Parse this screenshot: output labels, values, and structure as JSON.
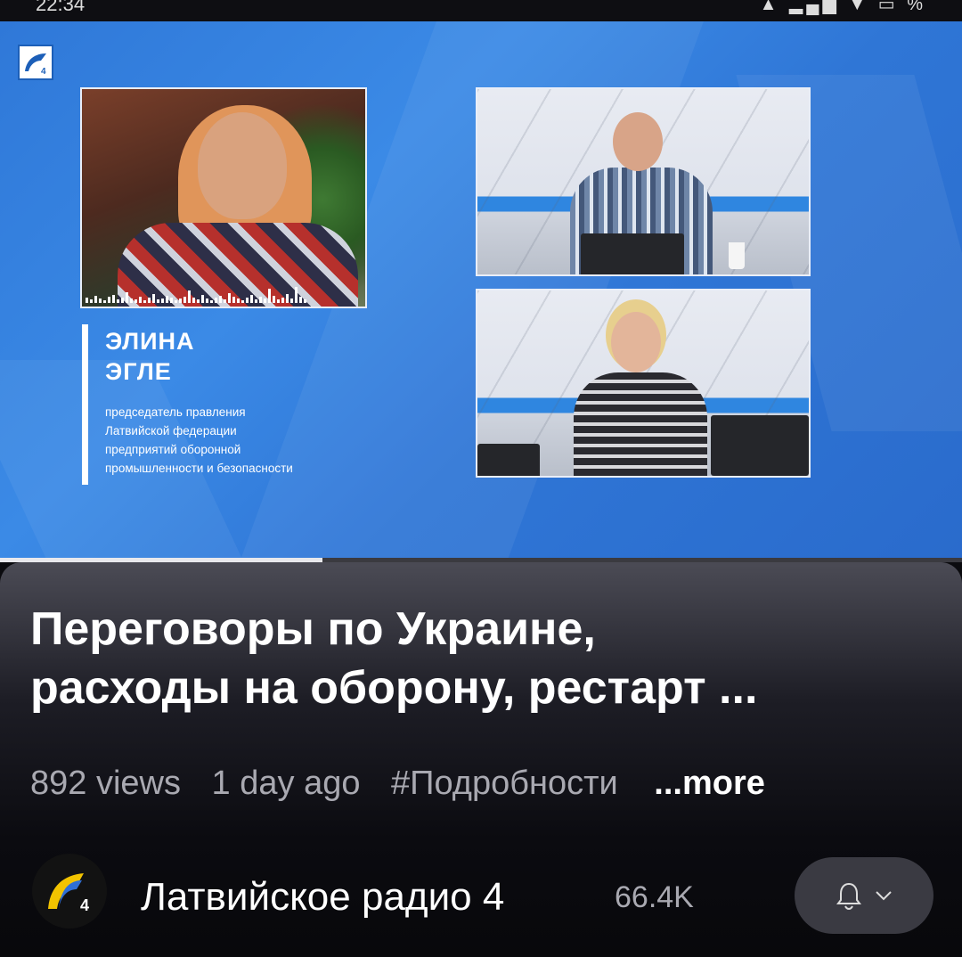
{
  "status_bar": {
    "time": "22:34",
    "icons_text": "▲ ▂▄▆ ▼ ▭ %"
  },
  "video": {
    "guest_name_line1": "ЭЛИНА",
    "guest_name_line2": "ЭГЛЕ",
    "guest_desc_line1": "председатель правления",
    "guest_desc_line2": "Латвийской федерации",
    "guest_desc_line3": "предприятий оборонной",
    "guest_desc_line4": "промышленности и безопасности",
    "progress_fraction": 0.335,
    "colors": {
      "background": "#3584e4",
      "progress": "#e8e8ec"
    }
  },
  "info": {
    "title_line1": "Переговоры по Украине,",
    "title_line2": "расходы на оборону, рестарт ...",
    "views": "892 views",
    "age": "1 day ago",
    "hashtag": "#Подробности",
    "more": "...more",
    "channel_name": "Латвийское радио 4",
    "subscribers": "66.4K",
    "avatar_icon": "latvian-radio-4-logo",
    "bell_icon": "bell-icon",
    "chevron_icon": "chevron-down-icon"
  }
}
